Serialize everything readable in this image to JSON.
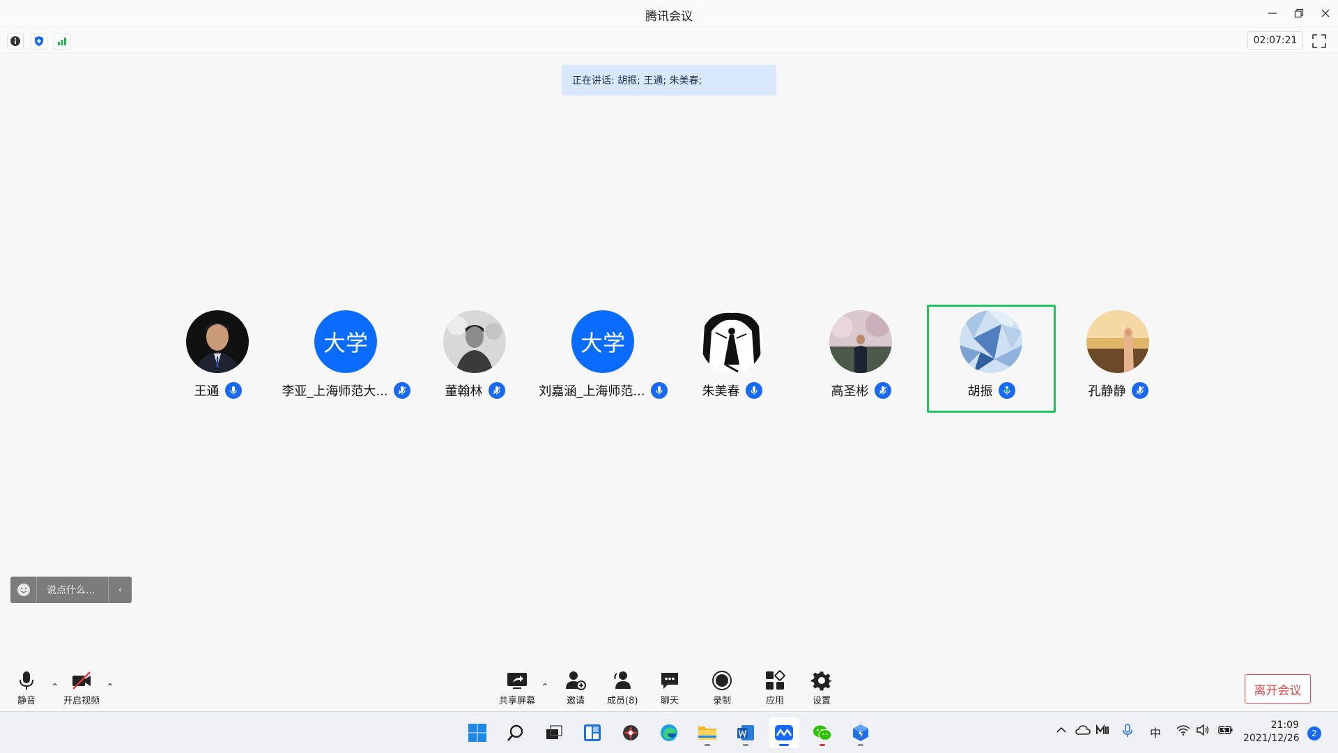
{
  "app": {
    "title": "腾讯会议"
  },
  "infobar": {
    "timer": "02:07:21"
  },
  "speaking": {
    "text": "正在讲话: 胡振; 王通; 朱美春;"
  },
  "participants": [
    {
      "name": "王通",
      "avatar_kind": "photo",
      "avatar_text": "",
      "mic": "on",
      "active": false
    },
    {
      "name": "李亚_上海师范大...",
      "avatar_kind": "text",
      "avatar_text": "大学",
      "mic": "muted",
      "active": false
    },
    {
      "name": "董翰林",
      "avatar_kind": "photo",
      "avatar_text": "",
      "mic": "muted",
      "active": false
    },
    {
      "name": "刘嘉涵_上海师范...",
      "avatar_kind": "text",
      "avatar_text": "大学",
      "mic": "on",
      "active": false
    },
    {
      "name": "朱美春",
      "avatar_kind": "photo",
      "avatar_text": "",
      "mic": "on",
      "active": false
    },
    {
      "name": "高圣彬",
      "avatar_kind": "photo",
      "avatar_text": "",
      "mic": "muted",
      "active": false
    },
    {
      "name": "胡振",
      "avatar_kind": "photo",
      "avatar_text": "",
      "mic": "speaking",
      "active": true
    },
    {
      "name": "孔静静",
      "avatar_kind": "photo",
      "avatar_text": "",
      "mic": "muted",
      "active": false
    }
  ],
  "chat": {
    "placeholder": "说点什么..."
  },
  "toolbar": {
    "mute": "静音",
    "video": "开启视频",
    "share": "共享屏幕",
    "invite": "邀请",
    "members": "成员(8)",
    "chat": "聊天",
    "record": "录制",
    "apps": "应用",
    "settings": "设置",
    "leave": "离开会议"
  },
  "taskbar": {
    "ime": "中",
    "time": "21:09",
    "date": "2021/12/26",
    "notifications": "2"
  },
  "colors": {
    "accent": "#1668f5",
    "speaking_border": "#22c55e",
    "leave": "#e24a4a",
    "banner": "#d9e8fb"
  }
}
